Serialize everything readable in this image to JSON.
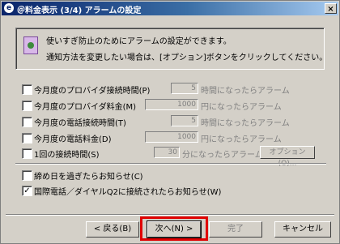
{
  "window": {
    "title": "＠料金表示 (3/4) アラームの設定",
    "app_icon": "e",
    "close_glyph": "×"
  },
  "info": {
    "icon": "note-icon",
    "line1": "使いすぎ防止のためにアラームの設定ができます。",
    "line2": "通知方法を変更したい場合は、[オプション]ボタンをクリックしてください。"
  },
  "alarms": {
    "provider_time": {
      "label": "今月度のプロバイダ接続時間(P)",
      "value": "5",
      "unit": "時間になったらアラーム",
      "checked": false
    },
    "provider_fee": {
      "label": "今月度のプロバイダ料金(M)",
      "value": "1000",
      "unit": "円になったらアラーム",
      "checked": false
    },
    "phone_time": {
      "label": "今月度の電話接続時間(T)",
      "value": "5",
      "unit": "時間になったらアラーム",
      "checked": false
    },
    "phone_fee": {
      "label": "今月度の電話料金(D)",
      "value": "1000",
      "unit": "円になったらアラーム",
      "checked": false
    },
    "session_time": {
      "label": "1回の接続時間(S)",
      "value": "30",
      "unit": "分になったらアラーム",
      "checked": false
    },
    "options_button": "オプション(O)..."
  },
  "notices": {
    "deadline": {
      "label": "締め日を過ぎたらお知らせ(C)",
      "checked": false
    },
    "intl": {
      "label": "国際電話／ダイヤルQ2に接続されたらお知らせ(W)",
      "checked": true
    }
  },
  "buttons": {
    "back": "< 戻る(B)",
    "next": "次へ(N) >",
    "finish": "完了",
    "cancel": "キャンセル"
  },
  "check_glyph": "✓",
  "colors": {
    "title_start": "#0a246a",
    "title_end": "#a6caf0",
    "dialog_bg": "#d4d0c8",
    "highlight": "#e00000"
  }
}
